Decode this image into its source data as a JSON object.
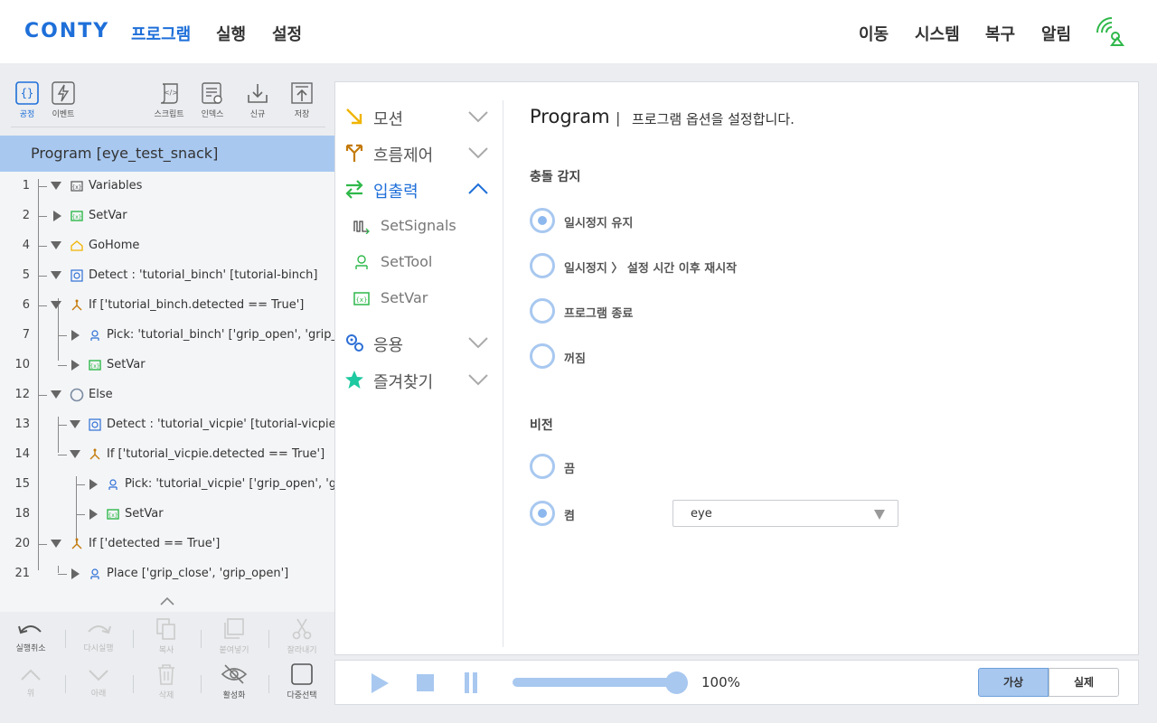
{
  "app": {
    "logo": "CONTY"
  },
  "nav": {
    "left": [
      "프로그램",
      "실행",
      "설정"
    ],
    "right": [
      "이동",
      "시스템",
      "복구",
      "알림"
    ],
    "active": 0
  },
  "toolbar": {
    "process": "공정",
    "event": "이벤트",
    "script": "스크립트",
    "index": "인덱스",
    "new": "신규",
    "save": "저장"
  },
  "tree": {
    "header": "Program [eye_test_snack]",
    "rows": [
      {
        "ln": "1",
        "label": "Variables"
      },
      {
        "ln": "2",
        "label": "SetVar"
      },
      {
        "ln": "4",
        "label": "GoHome"
      },
      {
        "ln": "5",
        "label": "Detect : 'tutorial_binch' [tutorial-binch]"
      },
      {
        "ln": "6",
        "label": "If ['tutorial_binch.detected == True']"
      },
      {
        "ln": "7",
        "label": "Pick: 'tutorial_binch' ['grip_open', 'grip_close']"
      },
      {
        "ln": "10",
        "label": "SetVar"
      },
      {
        "ln": "12",
        "label": "Else"
      },
      {
        "ln": "13",
        "label": "Detect : 'tutorial_vicpie' [tutorial-vicpie]"
      },
      {
        "ln": "14",
        "label": "If ['tutorial_vicpie.detected == True']"
      },
      {
        "ln": "15",
        "label": "Pick: 'tutorial_vicpie' ['grip_open', 'grip_close']"
      },
      {
        "ln": "18",
        "label": "SetVar"
      },
      {
        "ln": "20",
        "label": "If ['detected == True']"
      },
      {
        "ln": "21",
        "label": "Place ['grip_close', 'grip_open']"
      }
    ]
  },
  "edit": {
    "undo": "실행취소",
    "redo": "다시실행",
    "copy": "복사",
    "paste": "붙여넣기",
    "cut": "잘라내기",
    "up": "위",
    "down": "아래",
    "delete": "삭제",
    "enable": "활성화",
    "multiselect": "다중선택"
  },
  "commands": {
    "motion": "모션",
    "flow": "흐름제어",
    "io": "입출력",
    "io_items": [
      "SetSignals",
      "SetTool",
      "SetVar"
    ],
    "app": "응용",
    "favorites": "즐겨찾기"
  },
  "settings": {
    "title": "Program",
    "sep": "|",
    "subtitle": "프로그램 옵션을 설정합니다.",
    "collision": {
      "title": "충돌 감지",
      "options": [
        "일시정지 유지",
        "일시정지 〉 설정 시간 이후 재시작",
        "프로그램 종료",
        "꺼짐"
      ],
      "selected": 0
    },
    "vision": {
      "title": "비전",
      "options": [
        "끔",
        "켬"
      ],
      "selected": 1,
      "select_value": "eye"
    }
  },
  "player": {
    "speed": "100%",
    "speed_value": 100,
    "virtual": "가상",
    "real": "실제",
    "mode": "virtual"
  },
  "colors": {
    "accent": "#1e6fd9",
    "highlight": "#a8c8f0",
    "motion": "#f0b400",
    "flow": "#c47a0a",
    "io": "#2fb84a",
    "app": "#2d6fd6",
    "favorites": "#1dc9a0"
  }
}
